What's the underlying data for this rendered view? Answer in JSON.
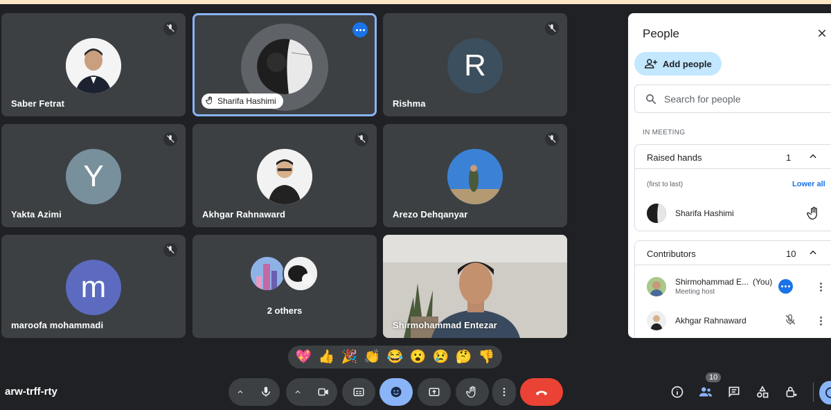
{
  "meeting": {
    "code": "arw-trff-rty"
  },
  "tiles": [
    {
      "name": "Saber Fetrat",
      "kind": "photo",
      "muted": true,
      "photo_color": "#6a7a8c"
    },
    {
      "name": "Sharifa Hashimi",
      "kind": "photo",
      "active": true,
      "hand_raised": true,
      "photo_color": "#2b2b2b"
    },
    {
      "name": "Rishma",
      "kind": "letter",
      "letter": "R",
      "muted": true,
      "color": "#3c4f5e"
    },
    {
      "name": "Yakta Azimi",
      "kind": "letter",
      "letter": "Y",
      "muted": true,
      "color": "#78909c"
    },
    {
      "name": "Akhgar Rahnaward",
      "kind": "photo",
      "muted": true,
      "photo_color": "#d8d2cc"
    },
    {
      "name": "Arezo Dehqanyar",
      "kind": "photo",
      "muted": true,
      "photo_color": "#3b7fd1"
    },
    {
      "name": "maroofa mohammadi",
      "kind": "letter",
      "letter": "m",
      "muted": true,
      "color": "#5c6bc0"
    },
    {
      "name": "2 others",
      "kind": "others"
    },
    {
      "name": "Shirmohammad Entezar",
      "kind": "video"
    }
  ],
  "reactions": [
    "💖",
    "👍",
    "🎉",
    "👏",
    "😂",
    "😮",
    "😢",
    "🤔",
    "👎"
  ],
  "controls": {
    "mic_icon": "mic-icon",
    "camera_icon": "camera-icon",
    "captions_icon": "captions-icon",
    "emoji_icon": "emoji-icon",
    "present_icon": "present-icon",
    "hand_icon": "raise-hand-icon",
    "more_icon": "more-options-icon",
    "end_call_icon": "end-call-icon",
    "accent_color": "#8ab4f8",
    "end_color": "#ea4335"
  },
  "right_bar": {
    "people_count": "10"
  },
  "people_panel": {
    "title": "People",
    "add_people_label": "Add people",
    "search_placeholder": "Search for people",
    "in_meeting_label": "IN MEETING",
    "raised_hands": {
      "title": "Raised hands",
      "count": "1",
      "hint": "(first to last)",
      "lower_all": "Lower all",
      "people": [
        {
          "name": "Sharifa Hashimi"
        }
      ]
    },
    "contributors": {
      "title": "Contributors",
      "count": "10",
      "people": [
        {
          "name": "Shirmohammad E...",
          "tag": "(You)",
          "sub": "Meeting host"
        },
        {
          "name": "Akhgar Rahnaward"
        }
      ]
    }
  }
}
